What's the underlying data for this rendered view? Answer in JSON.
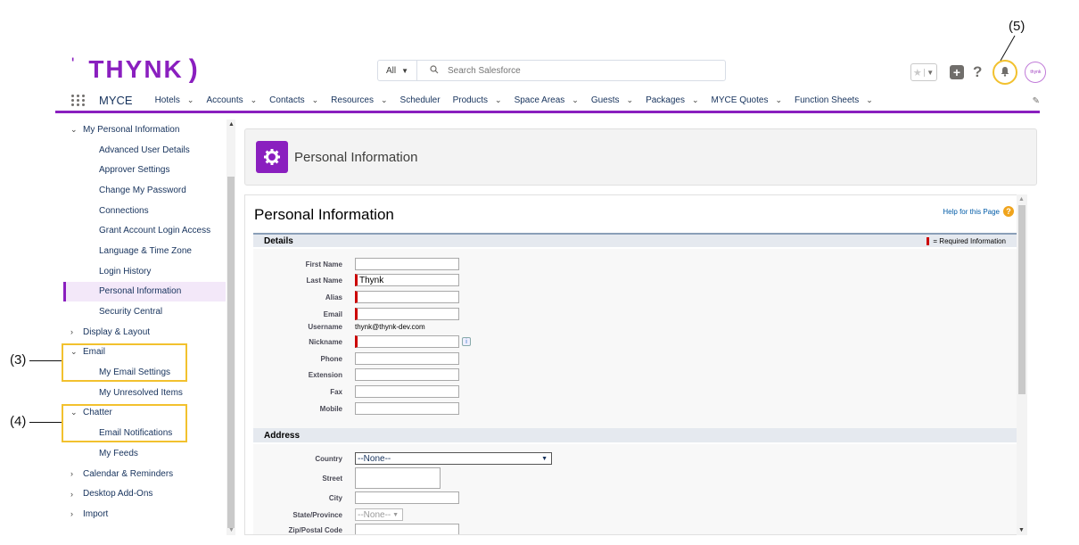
{
  "annotations": {
    "a3": "(3)",
    "a4": "(4)",
    "a5": "(5)"
  },
  "brand": {
    "logo_text": "THYNK",
    "accent": "#8a1fbf",
    "highlight": "#f2c12e"
  },
  "search": {
    "scope": "All",
    "placeholder": "Search Salesforce"
  },
  "header_icons": {
    "avatar_text": "thynk"
  },
  "nav": {
    "app_name": "MYCE",
    "items": [
      {
        "label": "Hotels",
        "dropdown": true
      },
      {
        "label": "Accounts",
        "dropdown": true
      },
      {
        "label": "Contacts",
        "dropdown": true
      },
      {
        "label": "Resources",
        "dropdown": true
      },
      {
        "label": "Scheduler",
        "dropdown": false
      },
      {
        "label": "Products",
        "dropdown": true
      },
      {
        "label": "Space Areas",
        "dropdown": true
      },
      {
        "label": "Guests",
        "dropdown": true
      },
      {
        "label": "Packages",
        "dropdown": true
      },
      {
        "label": "MYCE Quotes",
        "dropdown": true
      },
      {
        "label": "Function Sheets",
        "dropdown": true
      }
    ]
  },
  "sidebar": {
    "items": [
      {
        "label": "My Personal Information",
        "level": 0,
        "expanded": true
      },
      {
        "label": "Advanced User Details",
        "level": 1
      },
      {
        "label": "Approver Settings",
        "level": 1
      },
      {
        "label": "Change My Password",
        "level": 1
      },
      {
        "label": "Connections",
        "level": 1
      },
      {
        "label": "Grant Account Login Access",
        "level": 1
      },
      {
        "label": "Language & Time Zone",
        "level": 1
      },
      {
        "label": "Login History",
        "level": 1
      },
      {
        "label": "Personal Information",
        "level": 1,
        "active": true
      },
      {
        "label": "Security Central",
        "level": 1
      },
      {
        "label": "Display & Layout",
        "level": 0,
        "expanded": false
      },
      {
        "label": "Email",
        "level": 0,
        "expanded": true
      },
      {
        "label": "My Email Settings",
        "level": 1
      },
      {
        "label": "My Unresolved Items",
        "level": 1
      },
      {
        "label": "Chatter",
        "level": 0,
        "expanded": true
      },
      {
        "label": "Email Notifications",
        "level": 1
      },
      {
        "label": "My Feeds",
        "level": 1
      },
      {
        "label": "Calendar & Reminders",
        "level": 0,
        "expanded": false
      },
      {
        "label": "Desktop Add-Ons",
        "level": 0,
        "expanded": false
      },
      {
        "label": "Import",
        "level": 0,
        "expanded": false
      }
    ]
  },
  "page_header": {
    "title": "Personal Information"
  },
  "main": {
    "title": "Personal Information",
    "help_link": "Help for this Page",
    "details_section": "Details",
    "required_legend": "= Required Information",
    "details_fields": [
      {
        "label": "First Name",
        "value": "",
        "required": false,
        "type": "input"
      },
      {
        "label": "Last Name",
        "value": "Thynk",
        "required": true,
        "type": "input"
      },
      {
        "label": "Alias",
        "value": "",
        "required": true,
        "type": "input"
      },
      {
        "label": "Email",
        "value": "",
        "required": true,
        "type": "input"
      },
      {
        "label": "Username",
        "value": "thynk@thynk-dev.com",
        "required": false,
        "type": "text"
      },
      {
        "label": "Nickname",
        "value": "",
        "required": true,
        "type": "input",
        "info": "i"
      },
      {
        "label": "Phone",
        "value": "",
        "required": false,
        "type": "input"
      },
      {
        "label": "Extension",
        "value": "",
        "required": false,
        "type": "input"
      },
      {
        "label": "Fax",
        "value": "",
        "required": false,
        "type": "input"
      },
      {
        "label": "Mobile",
        "value": "",
        "required": false,
        "type": "input"
      }
    ],
    "address_section": "Address",
    "address_fields": [
      {
        "label": "Country",
        "value": "--None--",
        "type": "select"
      },
      {
        "label": "Street",
        "value": "",
        "type": "textarea"
      },
      {
        "label": "City",
        "value": "",
        "type": "input"
      },
      {
        "label": "State/Province",
        "value": "--None--",
        "type": "select-small"
      },
      {
        "label": "Zip/Postal Code",
        "value": "",
        "type": "input"
      }
    ]
  }
}
